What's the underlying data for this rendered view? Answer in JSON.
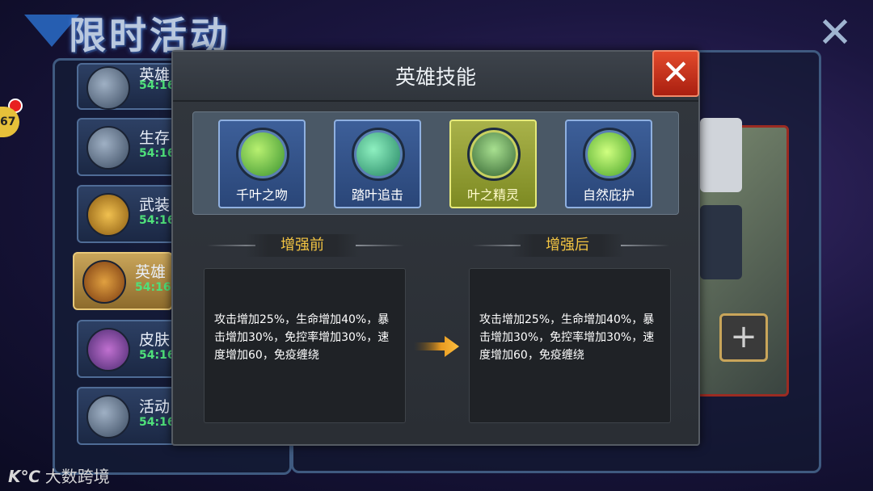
{
  "background": {
    "title": "限时活动",
    "badge_number": "67",
    "list_items": [
      {
        "name": "英雄",
        "time": "54:16"
      },
      {
        "name": "生存",
        "time": "54:16"
      },
      {
        "name": "武装",
        "time": "54:16"
      },
      {
        "name": "英雄",
        "time": "54:16"
      },
      {
        "name": "皮肤",
        "time": "54:16"
      },
      {
        "name": "活动",
        "time": "54:16"
      }
    ]
  },
  "dialog": {
    "title": "英雄技能",
    "skills": [
      {
        "label": "千叶之吻",
        "selected": false
      },
      {
        "label": "踏叶追击",
        "selected": false
      },
      {
        "label": "叶之精灵",
        "selected": true
      },
      {
        "label": "自然庇护",
        "selected": false
      }
    ],
    "before": {
      "title": "增强前",
      "text": "攻击增加25%，生命增加40%，暴击增加30%，免控率增加30%，速度增加60，免疫缠绕"
    },
    "after": {
      "title": "增强后",
      "text": "攻击增加25%，生命增加40%，暴击增加30%，免控率增加30%，速度增加60，免疫缠绕"
    }
  },
  "watermark": {
    "logo": "K℃",
    "text": "大数跨境"
  },
  "colors": {
    "accent_gold": "#f4c542",
    "close_red": "#c8321a",
    "skill_blue": "#3d5f99",
    "skill_selected": "#a9b24a"
  }
}
